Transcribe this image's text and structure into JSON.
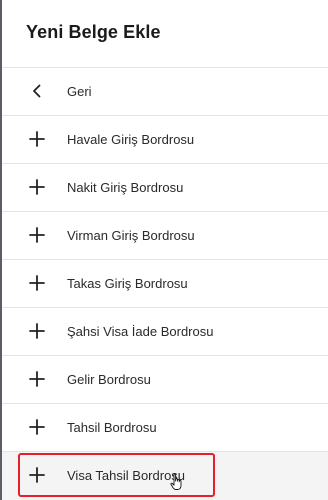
{
  "header": {
    "title": "Yeni Belge Ekle"
  },
  "menu": {
    "back": {
      "label": "Geri",
      "icon": "chevron-left-icon"
    },
    "items": [
      {
        "label": "Havale Giriş Bordrosu",
        "icon": "plus-icon"
      },
      {
        "label": "Nakit Giriş Bordrosu",
        "icon": "plus-icon"
      },
      {
        "label": "Virman Giriş Bordrosu",
        "icon": "plus-icon"
      },
      {
        "label": "Takas Giriş Bordrosu",
        "icon": "plus-icon"
      },
      {
        "label": "Şahsi Visa İade Bordrosu",
        "icon": "plus-icon"
      },
      {
        "label": "Gelir Bordrosu",
        "icon": "plus-icon"
      },
      {
        "label": "Tahsil Bordrosu",
        "icon": "plus-icon"
      },
      {
        "label": "Visa Tahsil Bordrosu",
        "icon": "plus-icon"
      }
    ]
  },
  "colors": {
    "highlight": "#e5202a",
    "separator": "#e3e3e3",
    "hover_background": "#f4f4f4",
    "text": "#2a2a2a"
  }
}
